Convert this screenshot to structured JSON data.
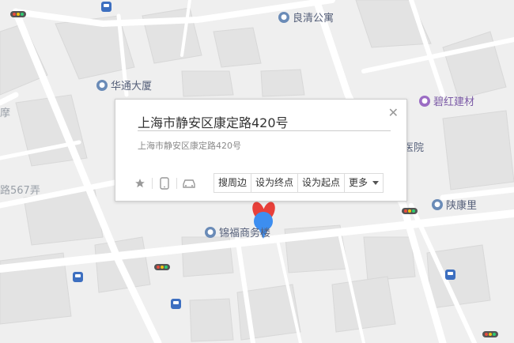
{
  "map": {
    "pois": [
      {
        "name": "良清公寓",
        "style": "blue"
      },
      {
        "name": "华通大厦",
        "style": "blue"
      },
      {
        "name": "碧红建材",
        "style": "purple"
      },
      {
        "name": "陕康里",
        "style": "blue"
      },
      {
        "name": "锦福商务楼",
        "style": "blue"
      }
    ],
    "labels": {
      "road_left": "路567弄",
      "partial_yuan": "医院",
      "partial_left": "摩"
    }
  },
  "popup": {
    "title": "上海市静安区康定路420号",
    "subtitle": "上海市静安区康定路420号",
    "close_icon": "close-icon",
    "icons": [
      "star-icon",
      "phone-icon",
      "car-icon"
    ],
    "actions": {
      "nearby": "搜周边",
      "set_end": "设为终点",
      "set_start": "设为起点",
      "more": "更多"
    }
  },
  "colors": {
    "marker_blue": "#3d8ef0",
    "marker_red": "#e8403a",
    "poi_blue": "#6a8bb7",
    "poi_purple": "#9b6cc4",
    "bus_blue": "#3d6fc0"
  }
}
